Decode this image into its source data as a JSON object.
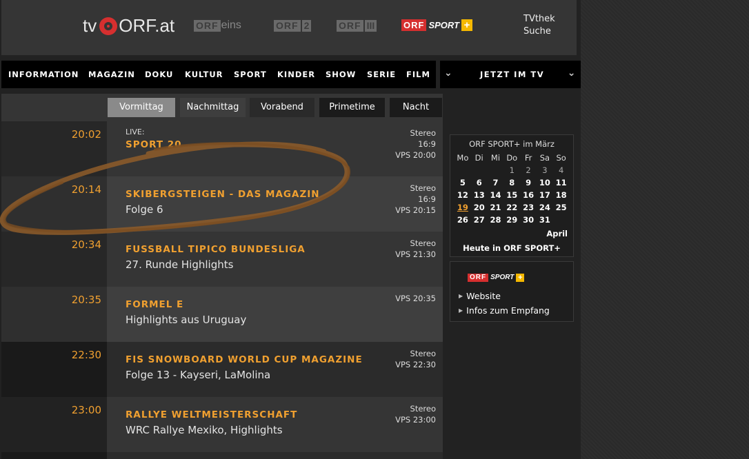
{
  "header": {
    "logo": "tv ORF.at",
    "logo_tv": "tv",
    "logo_orf": "ORF.at",
    "channels": [
      {
        "box": "ORF",
        "text": "eins"
      },
      {
        "box": "ORF",
        "num": "2"
      },
      {
        "box": "ORF",
        "num": "III"
      },
      {
        "box": "ORF",
        "text": "SPORT",
        "plus": "+"
      }
    ],
    "links": [
      "TVthek",
      "Suche"
    ]
  },
  "nav": {
    "items": [
      "INFORMATION",
      "MAGAZIN",
      "DOKU",
      "KULTUR",
      "SPORT",
      "KINDER",
      "SHOW",
      "SERIE",
      "FILM"
    ],
    "jetzt": "JETZT IM TV",
    "chevron": "⌄"
  },
  "tabs": [
    "Vormittag",
    "Nachmittag",
    "Vorabend",
    "Primetime",
    "Nacht"
  ],
  "schedule": [
    {
      "time": "20:02",
      "live": "LIVE:",
      "title": "SPORT 20",
      "sub": "",
      "meta": [
        "Stereo",
        "16:9",
        "VPS 20:00"
      ]
    },
    {
      "time": "20:14",
      "title": "SKIBERGSTEIGEN - DAS MAGAZIN",
      "sub": "Folge 6",
      "meta": [
        "Stereo",
        "16:9",
        "VPS 20:15"
      ]
    },
    {
      "time": "20:34",
      "title": "FUSSBALL TIPICO BUNDESLIGA",
      "sub": "27. Runde Highlights",
      "meta": [
        "Stereo",
        "VPS 21:30"
      ]
    },
    {
      "time": "20:35",
      "title": "FORMEL E",
      "sub": "Highlights aus Uruguay",
      "meta": [
        "VPS 20:35"
      ]
    },
    {
      "time": "22:30",
      "title": "FIS SNOWBOARD WORLD CUP MAGAZINE",
      "sub": "Folge 13 - Kayseri, LaMolina",
      "meta": [
        "Stereo",
        "VPS 22:30"
      ]
    },
    {
      "time": "23:00",
      "title": "RALLYE WELTMEISTERSCHAFT",
      "sub": "WRC Rallye Mexiko, Highlights",
      "meta": [
        "Stereo",
        "VPS 23:00"
      ]
    }
  ],
  "calendar": {
    "title": "ORF SPORT+ im März",
    "weekdays": [
      "Mo",
      "Di",
      "Mi",
      "Do",
      "Fr",
      "Sa",
      "So"
    ],
    "weeks": [
      [
        "",
        "",
        "",
        "1",
        "2",
        "3",
        "4"
      ],
      [
        "5",
        "6",
        "7",
        "8",
        "9",
        "10",
        "11"
      ],
      [
        "12",
        "13",
        "14",
        "15",
        "16",
        "17",
        "18"
      ],
      [
        "19",
        "20",
        "21",
        "22",
        "23",
        "24",
        "25"
      ],
      [
        "26",
        "27",
        "28",
        "29",
        "30",
        "31",
        ""
      ]
    ],
    "today": "19",
    "next_month": "April",
    "heute": "Heute in ORF SPORT+"
  },
  "infobox": {
    "links": [
      "Website",
      "Infos zum Empfang"
    ]
  },
  "colors": {
    "accent": "#f0a030",
    "orf_red": "#d62f2f",
    "plus_yellow": "#f5b800"
  }
}
